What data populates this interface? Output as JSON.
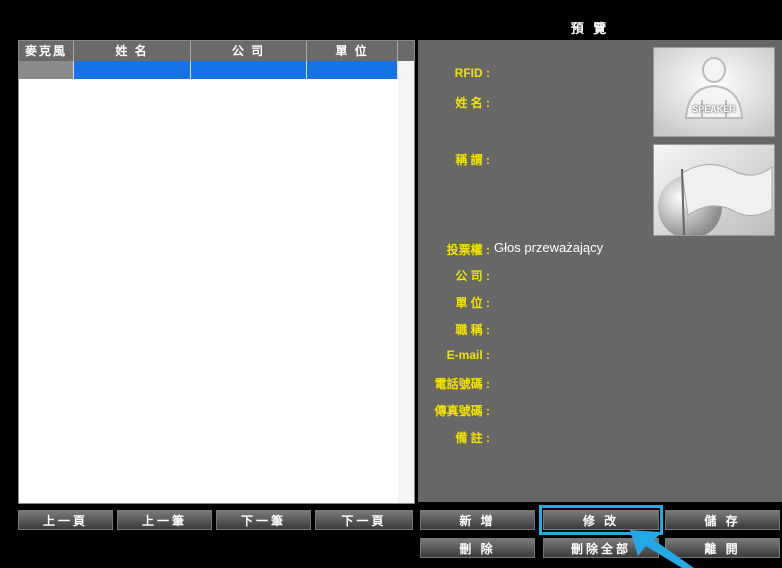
{
  "preview": {
    "title": "預 覽"
  },
  "list": {
    "columns": [
      "麥克風",
      "姓 名",
      "公 司",
      "單 位"
    ]
  },
  "fields": [
    {
      "key": "rfid",
      "label": "RFID :",
      "value": ""
    },
    {
      "key": "name",
      "label": "姓 名 :",
      "value": ""
    },
    {
      "key": "title",
      "label": "稱 謂 :",
      "value": ""
    },
    {
      "key": "vote",
      "label": "投票權 :",
      "value": "Głos przeważający"
    },
    {
      "key": "company",
      "label": "公 司 :",
      "value": ""
    },
    {
      "key": "unit",
      "label": "單 位 :",
      "value": ""
    },
    {
      "key": "jobtitle",
      "label": "職 稱 :",
      "value": ""
    },
    {
      "key": "email",
      "label": "E-mail :",
      "value": ""
    },
    {
      "key": "phone",
      "label": "電話號碼 :",
      "value": ""
    },
    {
      "key": "fax",
      "label": "傳真號碼 :",
      "value": ""
    },
    {
      "key": "note",
      "label": "備 註 :",
      "value": ""
    }
  ],
  "photo": {
    "speaker_text": "SPEAKER",
    "icon": "speaker-silhouette-icon",
    "flag_icon": "flag-icon"
  },
  "nav_buttons": [
    "上一頁",
    "上一筆",
    "下一筆",
    "下一頁"
  ],
  "action_buttons": {
    "add": "新 增",
    "edit": "修 改",
    "save": "儲 存",
    "delete": "刪 除",
    "delete_all": "刪除全部",
    "exit": "離 開"
  },
  "colors": {
    "accent": "#25a9e6",
    "label": "#f2e200",
    "selection": "#1673e6"
  }
}
